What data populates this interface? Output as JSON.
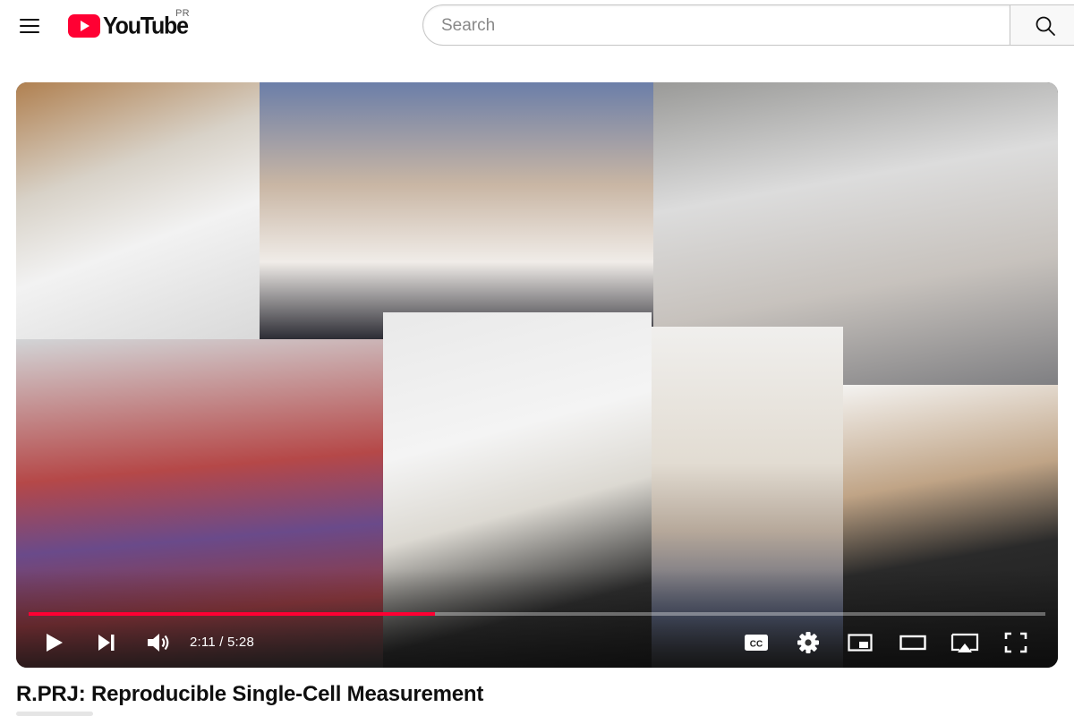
{
  "header": {
    "logo_text": "YouTube",
    "country_code": "PR",
    "search_placeholder": "Search"
  },
  "player": {
    "current_time": "2:11",
    "duration": "5:28",
    "time_separator": " / ",
    "progress": 0.4,
    "accent_color": "#ff0033",
    "controls": [
      "play-icon",
      "next-icon",
      "volume-icon",
      "captions-icon",
      "settings-icon",
      "miniplayer-icon",
      "theater-icon",
      "cast-icon",
      "fullscreen-icon"
    ]
  },
  "video": {
    "title": "R.PRJ: Reproducible Single-Cell Measurement"
  }
}
